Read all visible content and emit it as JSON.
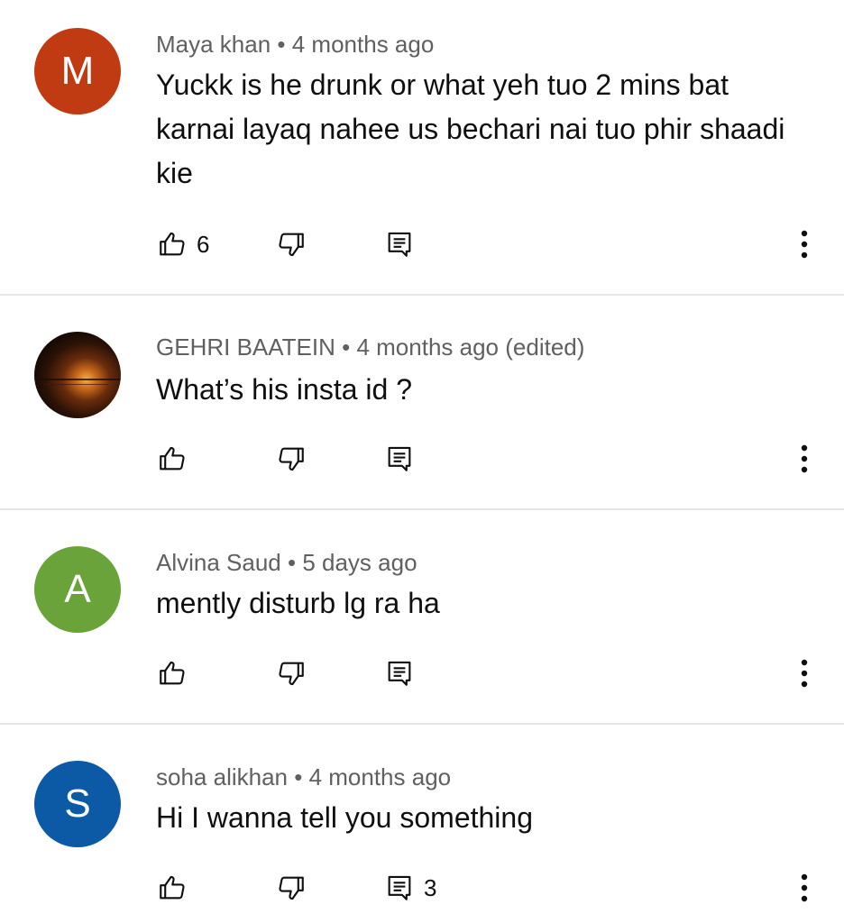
{
  "comments": [
    {
      "author": "Maya khan",
      "separator": " • ",
      "time": "4 months ago",
      "edited": "",
      "avatar_letter": "M",
      "avatar_color": "#c03b12",
      "text": "Yuckk is he drunk or what yeh tuo 2 mins bat karnai layaq nahee us bechari nai tuo phir shaadi kie",
      "like_count": "6",
      "reply_count": ""
    },
    {
      "author": "GEHRI BAATEIN",
      "separator": " • ",
      "time": "4 months ago",
      "edited": "(edited)",
      "avatar_letter": "",
      "avatar_color": "",
      "text": "What’s his insta id ?",
      "like_count": "",
      "reply_count": ""
    },
    {
      "author": "Alvina Saud",
      "separator": " • ",
      "time": "5 days ago",
      "edited": "",
      "avatar_letter": "A",
      "avatar_color": "#6aa33a",
      "text": "mently disturb lg ra ha",
      "like_count": "",
      "reply_count": ""
    },
    {
      "author": "soha alikhan",
      "separator": " • ",
      "time": "4 months ago",
      "edited": "",
      "avatar_letter": "S",
      "avatar_color": "#0c5aa6",
      "text": "Hi I wanna tell you something",
      "like_count": "",
      "reply_count": "3"
    }
  ],
  "icons": {
    "like": "thumbs-up-icon",
    "dislike": "thumbs-down-icon",
    "reply": "reply-comment-icon",
    "more": "more-vertical-icon"
  }
}
